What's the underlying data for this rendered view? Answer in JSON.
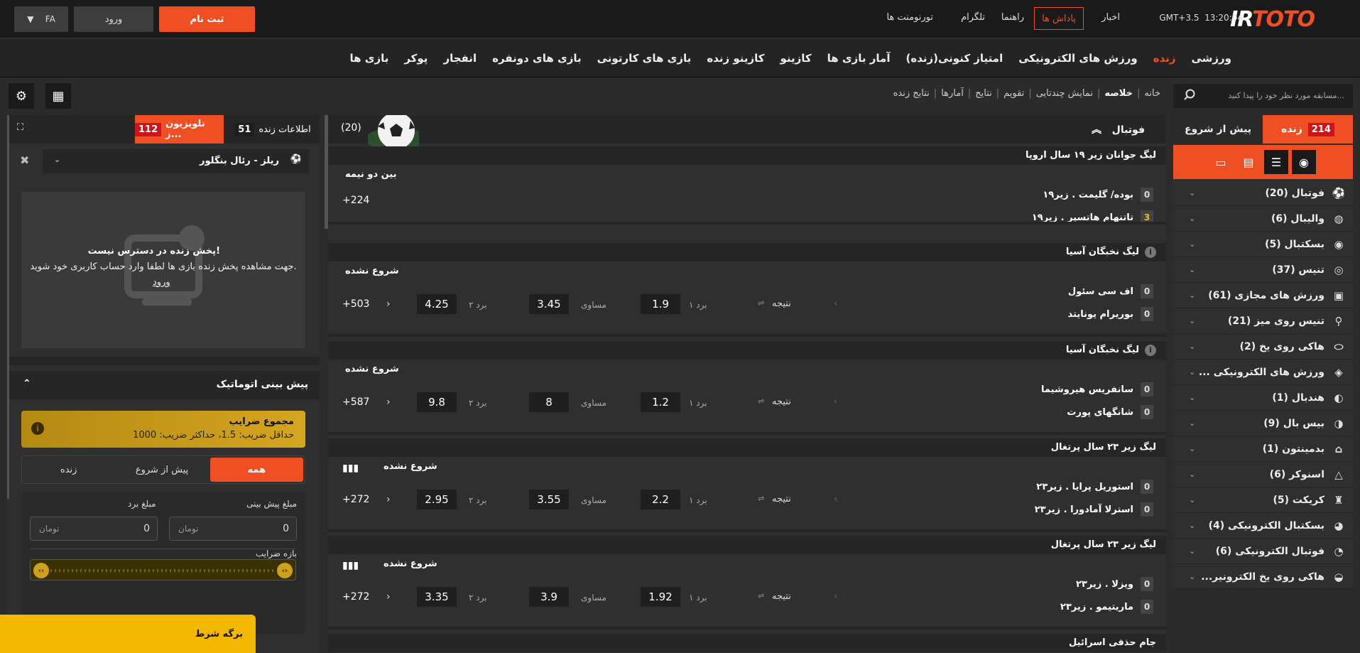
{
  "header": {
    "logo": "IRTOTO",
    "time": "13:20:04",
    "timezone": "GMT+3.5",
    "links": [
      "اخبار",
      "پاداش ها",
      "راهنما",
      "تلگرام",
      "تورنومنت ها"
    ],
    "register": "ثبت نام",
    "login": "ورود",
    "lang": "FA"
  },
  "nav": {
    "items": [
      "ورزشی",
      "زنده",
      "ورزش های الکترونیکی",
      "امتیاز کنونی(زنده)",
      "آمار بازی ها",
      "کازینو",
      "کازینو زنده",
      "بازی های کارتونی",
      "بازی های دونفره",
      "انفجار",
      "پوکر",
      "بازی ها"
    ],
    "active": "زنده"
  },
  "search": {
    "placeholder": "مسابقه مورد نظر خود را پیدا کنید..."
  },
  "breadcrumb": [
    "خانه",
    "خلاصه",
    "نمایش چندتایی",
    "تقویم",
    "نتایج",
    "آمارها",
    "نتایج زنده"
  ],
  "sidebar": {
    "tab_pre": "پیش از شروع",
    "tab_live": "زنده",
    "live_count": "214",
    "sports": [
      {
        "name": "فوتبال (20)",
        "icon": "soccer-icon"
      },
      {
        "name": "والیبال (6)",
        "icon": "volleyball-icon"
      },
      {
        "name": "بسکتبال (5)",
        "icon": "basketball-icon"
      },
      {
        "name": "تنیس (37)",
        "icon": "tennis-icon"
      },
      {
        "name": "ورزش های مجازی (61)",
        "icon": "virtual-icon"
      },
      {
        "name": "تنیس روی میز (21)",
        "icon": "table-tennis-icon"
      },
      {
        "name": "هاکی روی یخ (2)",
        "icon": "ice-hockey-icon"
      },
      {
        "name": "ورزش های الکترونیکی ...",
        "icon": "esports-icon"
      },
      {
        "name": "هندبال (1)",
        "icon": "handball-icon"
      },
      {
        "name": "بیس بال (9)",
        "icon": "baseball-icon"
      },
      {
        "name": "بدمینتون (1)",
        "icon": "badminton-icon"
      },
      {
        "name": "اسنوکر (6)",
        "icon": "snooker-icon"
      },
      {
        "name": "کریکت (5)",
        "icon": "cricket-icon"
      },
      {
        "name": "بسکتبال الکترونیکی (4)",
        "icon": "ebasketball-icon"
      },
      {
        "name": "فوتبال الکترونیکی (6)",
        "icon": "efootball-icon"
      },
      {
        "name": "هاکی روی یخ الکترونیر...",
        "icon": "eicehockey-icon"
      }
    ]
  },
  "center": {
    "title": "فوتبال",
    "count": "(20)",
    "label_result": "نتیجه",
    "label_w1": "برد ۱",
    "label_draw": "مساوی",
    "label_w2": "برد ۲",
    "leagues": [
      {
        "league": "لیگ جوانان زیر ۱۹ سال اروپا",
        "status": "بین دو نیمه",
        "team1": "بوده/ گلیمت . زیر۱۹",
        "s1": "0",
        "team2": "تاتنهام هاتسپر . زیر۱۹",
        "s2": "3",
        "more": "+224"
      },
      {
        "league": "لیگ نخبگان آسیا",
        "status": "شروع نشده",
        "team1": "اف سی سئول",
        "s1": "0",
        "team2": "بوریرام یونایتد",
        "s2": "0",
        "w1": "1.9",
        "x": "3.45",
        "w2": "4.25",
        "more": "+503"
      },
      {
        "league": "لیگ نخبگان آسیا",
        "status": "شروع نشده",
        "team1": "سانفریس هیروشیما",
        "s1": "0",
        "team2": "شانگهای پورت",
        "s2": "0",
        "w1": "1.2",
        "x": "8",
        "w2": "9.8",
        "more": "+587"
      },
      {
        "league": "لیگ زیر ۲۳ سال پرتغال",
        "status": "شروع نشده",
        "team1": "استوریل پرایا . زیر۲۳",
        "s1": "0",
        "team2": "استرلا آمادورا . زیر۲۳",
        "s2": "0",
        "w1": "2.2",
        "x": "3.55",
        "w2": "2.95",
        "more": "+272"
      },
      {
        "league": "لیگ زیر ۲۳ سال پرتغال",
        "status": "شروع نشده",
        "team1": "ویزلا . زیر۲۳",
        "s1": "0",
        "team2": "ماریتیمو . زیر۲۳",
        "s2": "0",
        "w1": "1.92",
        "x": "3.9",
        "w2": "3.35",
        "more": "+272"
      },
      {
        "league": "جام حذفی اسرائیل"
      }
    ]
  },
  "rightpanel": {
    "live_info": "اطلاعات زنده",
    "live_info_count": "51",
    "tv": "تلویزیون ز...",
    "tv_count": "112",
    "match_select": "ریلز - رئال بنگلور",
    "stream_title": "پخش زنده در دسترس نیست!",
    "stream_msg": "جهت مشاهده پخش زنده بازی ها لطفا وارد حساب کاربری خود شوید.",
    "stream_login": "ورود",
    "auto_title": "پیش بینی اتوماتیک",
    "odds_title": "مجموع ضرایب",
    "odds_sub": "حداقل ضریب: 1.5، حداکثر ضریب: 1000",
    "seg": [
      "همه",
      "پیش از شروع",
      "زنده"
    ],
    "stake_label": "مبلغ پیش بینی",
    "win_label": "مبلغ برد",
    "stake_value": "0",
    "win_value": "0",
    "currency": "تومان",
    "range_label": "بازه ضرایب"
  },
  "betslip": "برگه شرط"
}
